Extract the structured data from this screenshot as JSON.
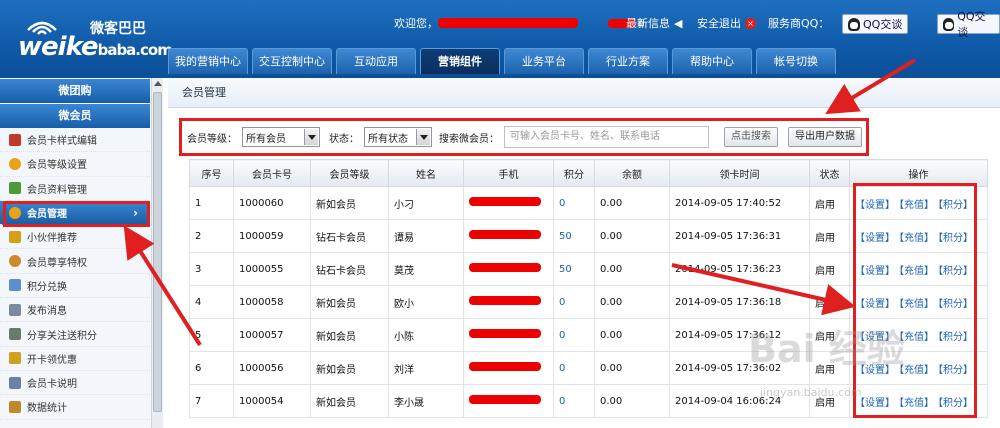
{
  "header": {
    "logo_main": "weike",
    "logo_sub": "baba.com",
    "logo_cn": "微客巴巴",
    "welcome": "欢迎您，",
    "news": "最新信息",
    "logout": "安全退出",
    "provider_qq": "服务商QQ：",
    "qq_btn1": "QQ交谈",
    "qq_btn2": "QQ交谈"
  },
  "nav": [
    {
      "label": "我的营销中心"
    },
    {
      "label": "交互控制中心"
    },
    {
      "label": "互动应用"
    },
    {
      "label": "营销组件"
    },
    {
      "label": "业务平台"
    },
    {
      "label": "行业方案"
    },
    {
      "label": "帮助中心"
    },
    {
      "label": "帐号切换"
    }
  ],
  "sidebar": {
    "heads": [
      "微团购",
      "微会员"
    ],
    "items": [
      {
        "label": "会员卡样式编辑",
        "icon": "card-style-icon",
        "color": "#c0392b"
      },
      {
        "label": "会员等级设置",
        "icon": "medal-icon",
        "color": "#e8a317"
      },
      {
        "label": "会员资料管理",
        "icon": "profile-icon",
        "color": "#4a9a3a"
      },
      {
        "label": "会员管理",
        "icon": "member-icon",
        "color": "#e8a317"
      },
      {
        "label": "小伙伴推荐",
        "icon": "recommend-icon",
        "color": "#d4a017"
      },
      {
        "label": "会员尊享特权",
        "icon": "privilege-icon",
        "color": "#d08a2a"
      },
      {
        "label": "积分兑换",
        "icon": "points-icon",
        "color": "#5a8fd0"
      },
      {
        "label": "发布消息",
        "icon": "message-icon",
        "color": "#7a8aa0"
      },
      {
        "label": "分享关注送积分",
        "icon": "share-icon",
        "color": "#6a7a6a"
      },
      {
        "label": "开卡领优惠",
        "icon": "coupon-icon",
        "color": "#d0a020"
      },
      {
        "label": "会员卡说明",
        "icon": "doc-icon",
        "color": "#6a80a8"
      },
      {
        "label": "数据统计",
        "icon": "stats-icon",
        "color": "#c0882a"
      }
    ]
  },
  "breadcrumb": "会员管理",
  "filter": {
    "level_label": "会员等级：",
    "level_value": "所有会员",
    "status_label": "状态：",
    "status_value": "所有状态",
    "search_label": "搜索微会员：",
    "search_placeholder": "可输入会员卡号、姓名、联系电话",
    "search_button": "点击搜索",
    "export_button": "导出用户数据"
  },
  "table": {
    "headers": [
      "序号",
      "会员卡号",
      "会员等级",
      "姓名",
      "手机",
      "积分",
      "余额",
      "领卡时间",
      "状态",
      "操作"
    ],
    "rows": [
      [
        "1",
        "1000060",
        "新如会员",
        "小刁",
        "",
        "0",
        "0.00",
        "2014-09-05 17:40:52",
        "启用"
      ],
      [
        "2",
        "1000059",
        "钻石卡会员",
        "谭易",
        "",
        "50",
        "0.00",
        "2014-09-05 17:36:31",
        "启用"
      ],
      [
        "3",
        "1000055",
        "钻石卡会员",
        "莫茂",
        "",
        "50",
        "0.00",
        "2014-09-05 17:36:23",
        "启用"
      ],
      [
        "4",
        "1000058",
        "新如会员",
        "欧小",
        "",
        "0",
        "0.00",
        "2014-09-05 17:36:18",
        "启用"
      ],
      [
        "5",
        "1000057",
        "新如会员",
        "小陈",
        "",
        "0",
        "0.00",
        "2014-09-05 17:36:12",
        "启用"
      ],
      [
        "6",
        "1000056",
        "新如会员",
        "刘洋",
        "",
        "0",
        "0.00",
        "2014-09-05 17:36:02",
        "启用"
      ],
      [
        "7",
        "1000054",
        "新如会员",
        "李小晟",
        "",
        "0",
        "0.00",
        "2014-09-04 16:06:24",
        "启用"
      ]
    ],
    "ops": [
      "【设置】",
      "【充值】",
      "【积分】"
    ]
  },
  "watermark": "Bai 经验",
  "watermark_url": "jingyan.baidu.com",
  "colors": {
    "accent": "#1d62ad",
    "highlight": "#e02020",
    "link": "#1a64b8"
  }
}
